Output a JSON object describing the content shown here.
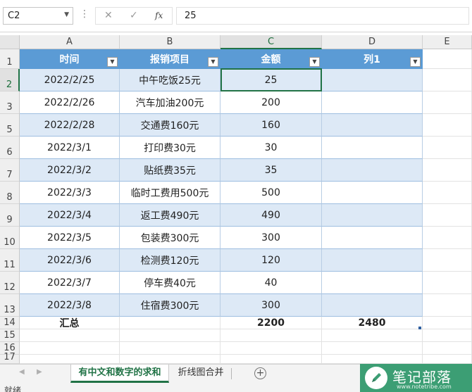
{
  "formula_bar": {
    "name_box": "C2",
    "cancel_glyph": "✕",
    "enter_glyph": "✓",
    "function_label": "fx",
    "formula": "25"
  },
  "columns": [
    "A",
    "B",
    "C",
    "D",
    "E"
  ],
  "rows": [
    {
      "num": "1",
      "style": "header",
      "cells": [
        "时间",
        "报销项目",
        "金额",
        "列1"
      ]
    },
    {
      "num": "2",
      "style": "band",
      "cells": [
        "2022/2/25",
        "中午吃饭25元",
        "25",
        ""
      ]
    },
    {
      "num": "3",
      "style": "white",
      "cells": [
        "2022/2/26",
        "汽车加油200元",
        "200",
        ""
      ]
    },
    {
      "num": "5",
      "style": "band",
      "cells": [
        "2022/2/28",
        "交通费160元",
        "160",
        ""
      ]
    },
    {
      "num": "6",
      "style": "white",
      "cells": [
        "2022/3/1",
        "打印费30元",
        "30",
        ""
      ]
    },
    {
      "num": "7",
      "style": "band",
      "cells": [
        "2022/3/2",
        "贴纸费35元",
        "35",
        ""
      ]
    },
    {
      "num": "8",
      "style": "white",
      "cells": [
        "2022/3/3",
        "临时工费用500元",
        "500",
        ""
      ]
    },
    {
      "num": "9",
      "style": "band",
      "cells": [
        "2022/3/4",
        "返工费490元",
        "490",
        ""
      ]
    },
    {
      "num": "10",
      "style": "white",
      "cells": [
        "2022/3/5",
        "包装费300元",
        "300",
        ""
      ]
    },
    {
      "num": "11",
      "style": "band",
      "cells": [
        "2022/3/6",
        "检测费120元",
        "120",
        ""
      ]
    },
    {
      "num": "12",
      "style": "white",
      "cells": [
        "2022/3/7",
        "停车费40元",
        "40",
        ""
      ]
    },
    {
      "num": "13",
      "style": "band",
      "cells": [
        "2022/3/8",
        "住宿费300元",
        "300",
        ""
      ]
    },
    {
      "num": "14",
      "style": "total",
      "cells": [
        "汇总",
        "",
        "2200",
        "2480"
      ]
    },
    {
      "num": "15",
      "style": "plain",
      "cells": [
        "",
        "",
        "",
        ""
      ]
    },
    {
      "num": "16",
      "style": "plain",
      "cells": [
        "",
        "",
        "",
        ""
      ]
    },
    {
      "num": "17",
      "style": "plain",
      "cells": [
        "",
        "",
        "",
        ""
      ]
    }
  ],
  "sheet_tabs": [
    {
      "label": "有中文和数字的求和",
      "active": true
    },
    {
      "label": "折线图合并",
      "active": false
    }
  ],
  "add_sheet_glyph": "+",
  "status": "就绪",
  "watermark": {
    "title": "笔记部落",
    "url": "www.notetribe.com"
  },
  "colors": {
    "header": "#5b9bd5",
    "band": "#dde9f6",
    "accent": "#217346",
    "watermark": "#3c9e74"
  }
}
